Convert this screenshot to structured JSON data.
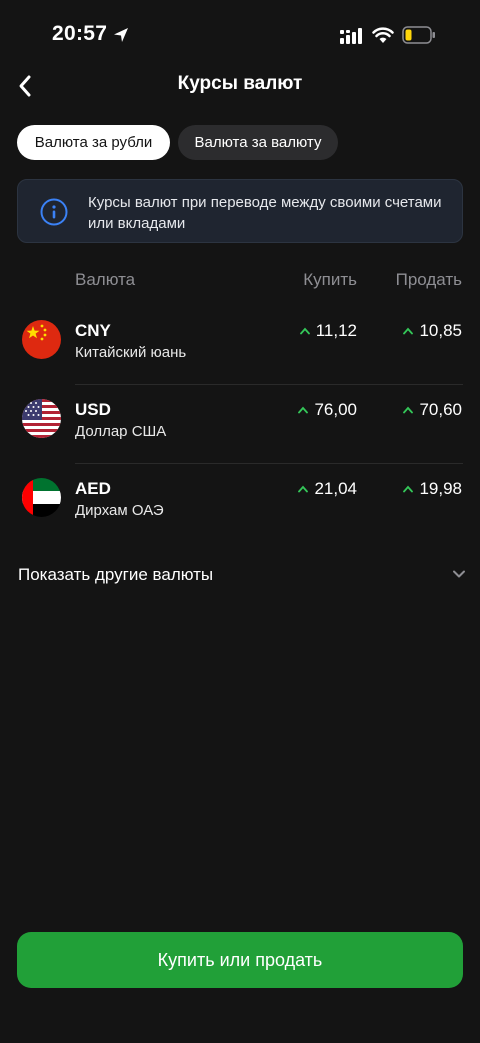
{
  "status_bar": {
    "time": "20:57"
  },
  "header": {
    "title": "Курсы валют"
  },
  "tabs": [
    {
      "label": "Валюта за рубли",
      "active": true
    },
    {
      "label": "Валюта за валюту",
      "active": false
    }
  ],
  "info": {
    "text": "Курсы валют при переводе между своими счетами или вкладами"
  },
  "table": {
    "headers": {
      "currency": "Валюта",
      "buy": "Купить",
      "sell": "Продать"
    },
    "rows": [
      {
        "code": "CNY",
        "name": "Китайский юань",
        "buy": "11,12",
        "sell": "10,85",
        "flag": "china-flag-icon",
        "buy_trend": "up",
        "sell_trend": "up"
      },
      {
        "code": "USD",
        "name": "Доллар США",
        "buy": "76,00",
        "sell": "70,60",
        "flag": "usa-flag-icon",
        "buy_trend": "up",
        "sell_trend": "up"
      },
      {
        "code": "AED",
        "name": "Дирхам ОАЭ",
        "buy": "21,04",
        "sell": "19,98",
        "flag": "uae-flag-icon",
        "buy_trend": "up",
        "sell_trend": "up"
      }
    ]
  },
  "show_more": {
    "label": "Показать другие валюты"
  },
  "action": {
    "label": "Купить или продать"
  },
  "colors": {
    "accent": "#21a038",
    "background": "#141414",
    "trend_up": "#34c759"
  }
}
